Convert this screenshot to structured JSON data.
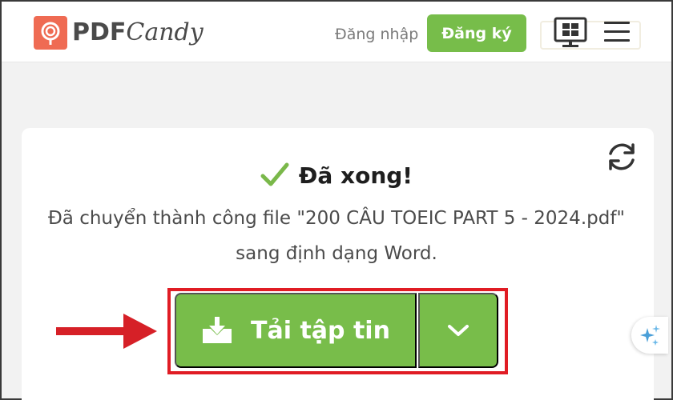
{
  "header": {
    "logo_pdf": "PDF",
    "logo_candy": "Candy",
    "login_label": "Đăng nhập",
    "signup_label": "Đăng ký"
  },
  "result": {
    "title": "Đã xong!",
    "message_line1": "Đã chuyển thành công file \"200 CÂU TOEIC PART 5 - 2024.pdf\"",
    "message_line2": "sang định dạng Word."
  },
  "actions": {
    "download_label": "Tải tập tin"
  },
  "colors": {
    "brand_green": "#78bd4a",
    "logo_orange": "#ef6b53",
    "highlight_red": "#e01c24"
  },
  "icons": [
    "logo-candy-icon",
    "desktop-windows-icon",
    "menu-icon",
    "refresh-icon",
    "check-icon",
    "download-icon",
    "chevron-down-icon",
    "red-arrow-icon",
    "sparkle-icon"
  ]
}
